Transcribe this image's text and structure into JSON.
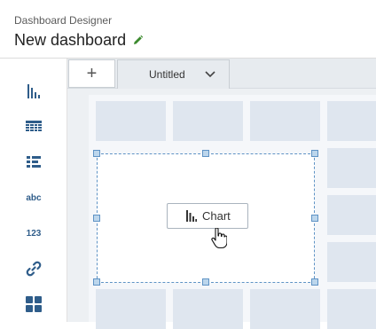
{
  "header": {
    "app_name": "Dashboard Designer",
    "title": "New dashboard",
    "edit_icon": "pencil-icon",
    "edit_icon_color": "#3c8a2e"
  },
  "left_rail": {
    "items": [
      {
        "icon": "bar-chart-icon"
      },
      {
        "icon": "table-grid-icon"
      },
      {
        "icon": "list-icon"
      },
      {
        "icon": "text-abc-icon",
        "label": "abc"
      },
      {
        "icon": "number-123-icon",
        "label": "123"
      },
      {
        "icon": "link-icon"
      },
      {
        "icon": "dashboard-tiles-icon"
      }
    ]
  },
  "tabs": {
    "add_label": "+",
    "items": [
      {
        "label": "Untitled"
      }
    ]
  },
  "canvas": {
    "selected_widget_label": "Chart",
    "selected_widget_icon": "bar-chart-icon"
  },
  "colors": {
    "accent": "#2f5d8a",
    "selection": "#5f93c5",
    "cell": "#dfe6ef"
  }
}
